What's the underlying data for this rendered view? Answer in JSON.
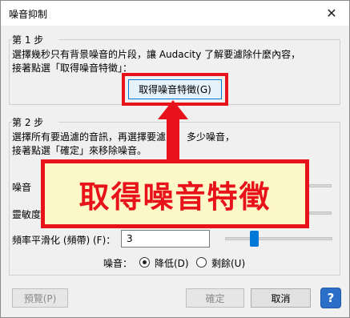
{
  "window": {
    "title": "噪音抑制",
    "close_glyph": "✕"
  },
  "step1": {
    "label": "第 1 步",
    "line1": "選擇幾秒只有背景噪音的片段，讓 Audacity 了解要濾除什麼內容，",
    "line2": "接著點選「取得噪音特徵」：",
    "get_profile_button": "取得噪音特徵(G)"
  },
  "step2": {
    "label": "第 2 步",
    "line1": "選擇所有要過濾的音訊，再選擇要濾",
    "line1_tail": "多少噪音，",
    "line2": "接著點選「確定」來移除噪音。",
    "row1_label": "噪音",
    "row2_label": "靈敏度",
    "freq_label": "頻率平滑化 (頻帶) (F)：",
    "freq_value": "3",
    "noise_label": "噪音：",
    "radio_reduce": "降低(D)",
    "radio_residue": "剩餘(U)"
  },
  "callout": {
    "text": "取得噪音特徵"
  },
  "footer": {
    "preview_button": "預覽(P)",
    "ok_button": "確定",
    "cancel_button": "取消",
    "help_glyph": "?"
  },
  "colors": {
    "highlight_red": "#e8121b",
    "callout_bg": "#fdf8c8",
    "accent_blue": "#0078d7"
  }
}
